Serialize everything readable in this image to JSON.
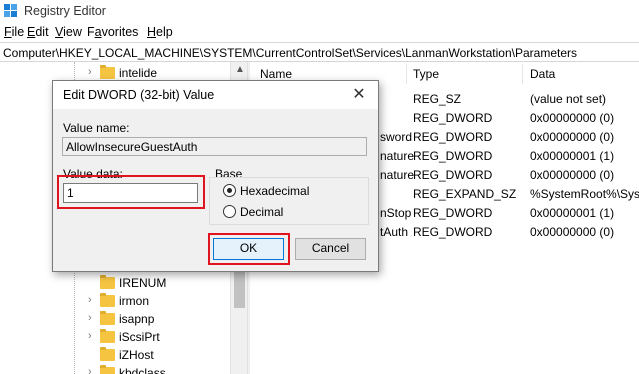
{
  "window": {
    "title": "Registry Editor"
  },
  "menu": [
    "File",
    "Edit",
    "View",
    "Favorites",
    "Help"
  ],
  "menu_accel": [
    "F",
    "E",
    "V",
    "a",
    "H"
  ],
  "address": "Computer\\HKEY_LOCAL_MACHINE\\SYSTEM\\CurrentControlSet\\Services\\LanmanWorkstation\\Parameters",
  "tree": {
    "items": [
      {
        "name": "intelide"
      },
      {
        "name": "IRENUM"
      },
      {
        "name": "irmon"
      },
      {
        "name": "isapnp"
      },
      {
        "name": "iScsiPrt"
      },
      {
        "name": "iZHost"
      },
      {
        "name": "kbdclass"
      }
    ]
  },
  "list": {
    "headers": {
      "name": "Name",
      "type": "Type",
      "data": "Data"
    },
    "rows": [
      {
        "name": "",
        "type": "REG_SZ",
        "data": "(value not set)"
      },
      {
        "name": "",
        "type": "REG_DWORD",
        "data": "0x00000000 (0)"
      },
      {
        "name": "sword",
        "type": "REG_DWORD",
        "data": "0x00000000 (0)"
      },
      {
        "name": "nature",
        "type": "REG_DWORD",
        "data": "0x00000001 (1)"
      },
      {
        "name": "nature",
        "type": "REG_DWORD",
        "data": "0x00000000 (0)"
      },
      {
        "name": "",
        "type": "REG_EXPAND_SZ",
        "data": "%SystemRoot%\\Syste"
      },
      {
        "name": "nStop",
        "type": "REG_DWORD",
        "data": "0x00000001 (1)"
      },
      {
        "name": "tAuth",
        "type": "REG_DWORD",
        "data": "0x00000000 (0)"
      }
    ]
  },
  "dialog": {
    "title": "Edit DWORD (32-bit) Value",
    "value_name_label": "Value name:",
    "value_name": "AllowInsecureGuestAuth",
    "value_data_label": "Value data:",
    "value_data": "1",
    "base_label": "Base",
    "radio_hex": "Hexadecimal",
    "radio_dec": "Decimal",
    "base_selected": "Hexadecimal",
    "ok_label": "OK",
    "cancel_label": "Cancel",
    "close_glyph": "✕"
  },
  "colors": {
    "highlight": "#e0141e",
    "accent": "#0078d7",
    "folder": "#f5c542"
  }
}
